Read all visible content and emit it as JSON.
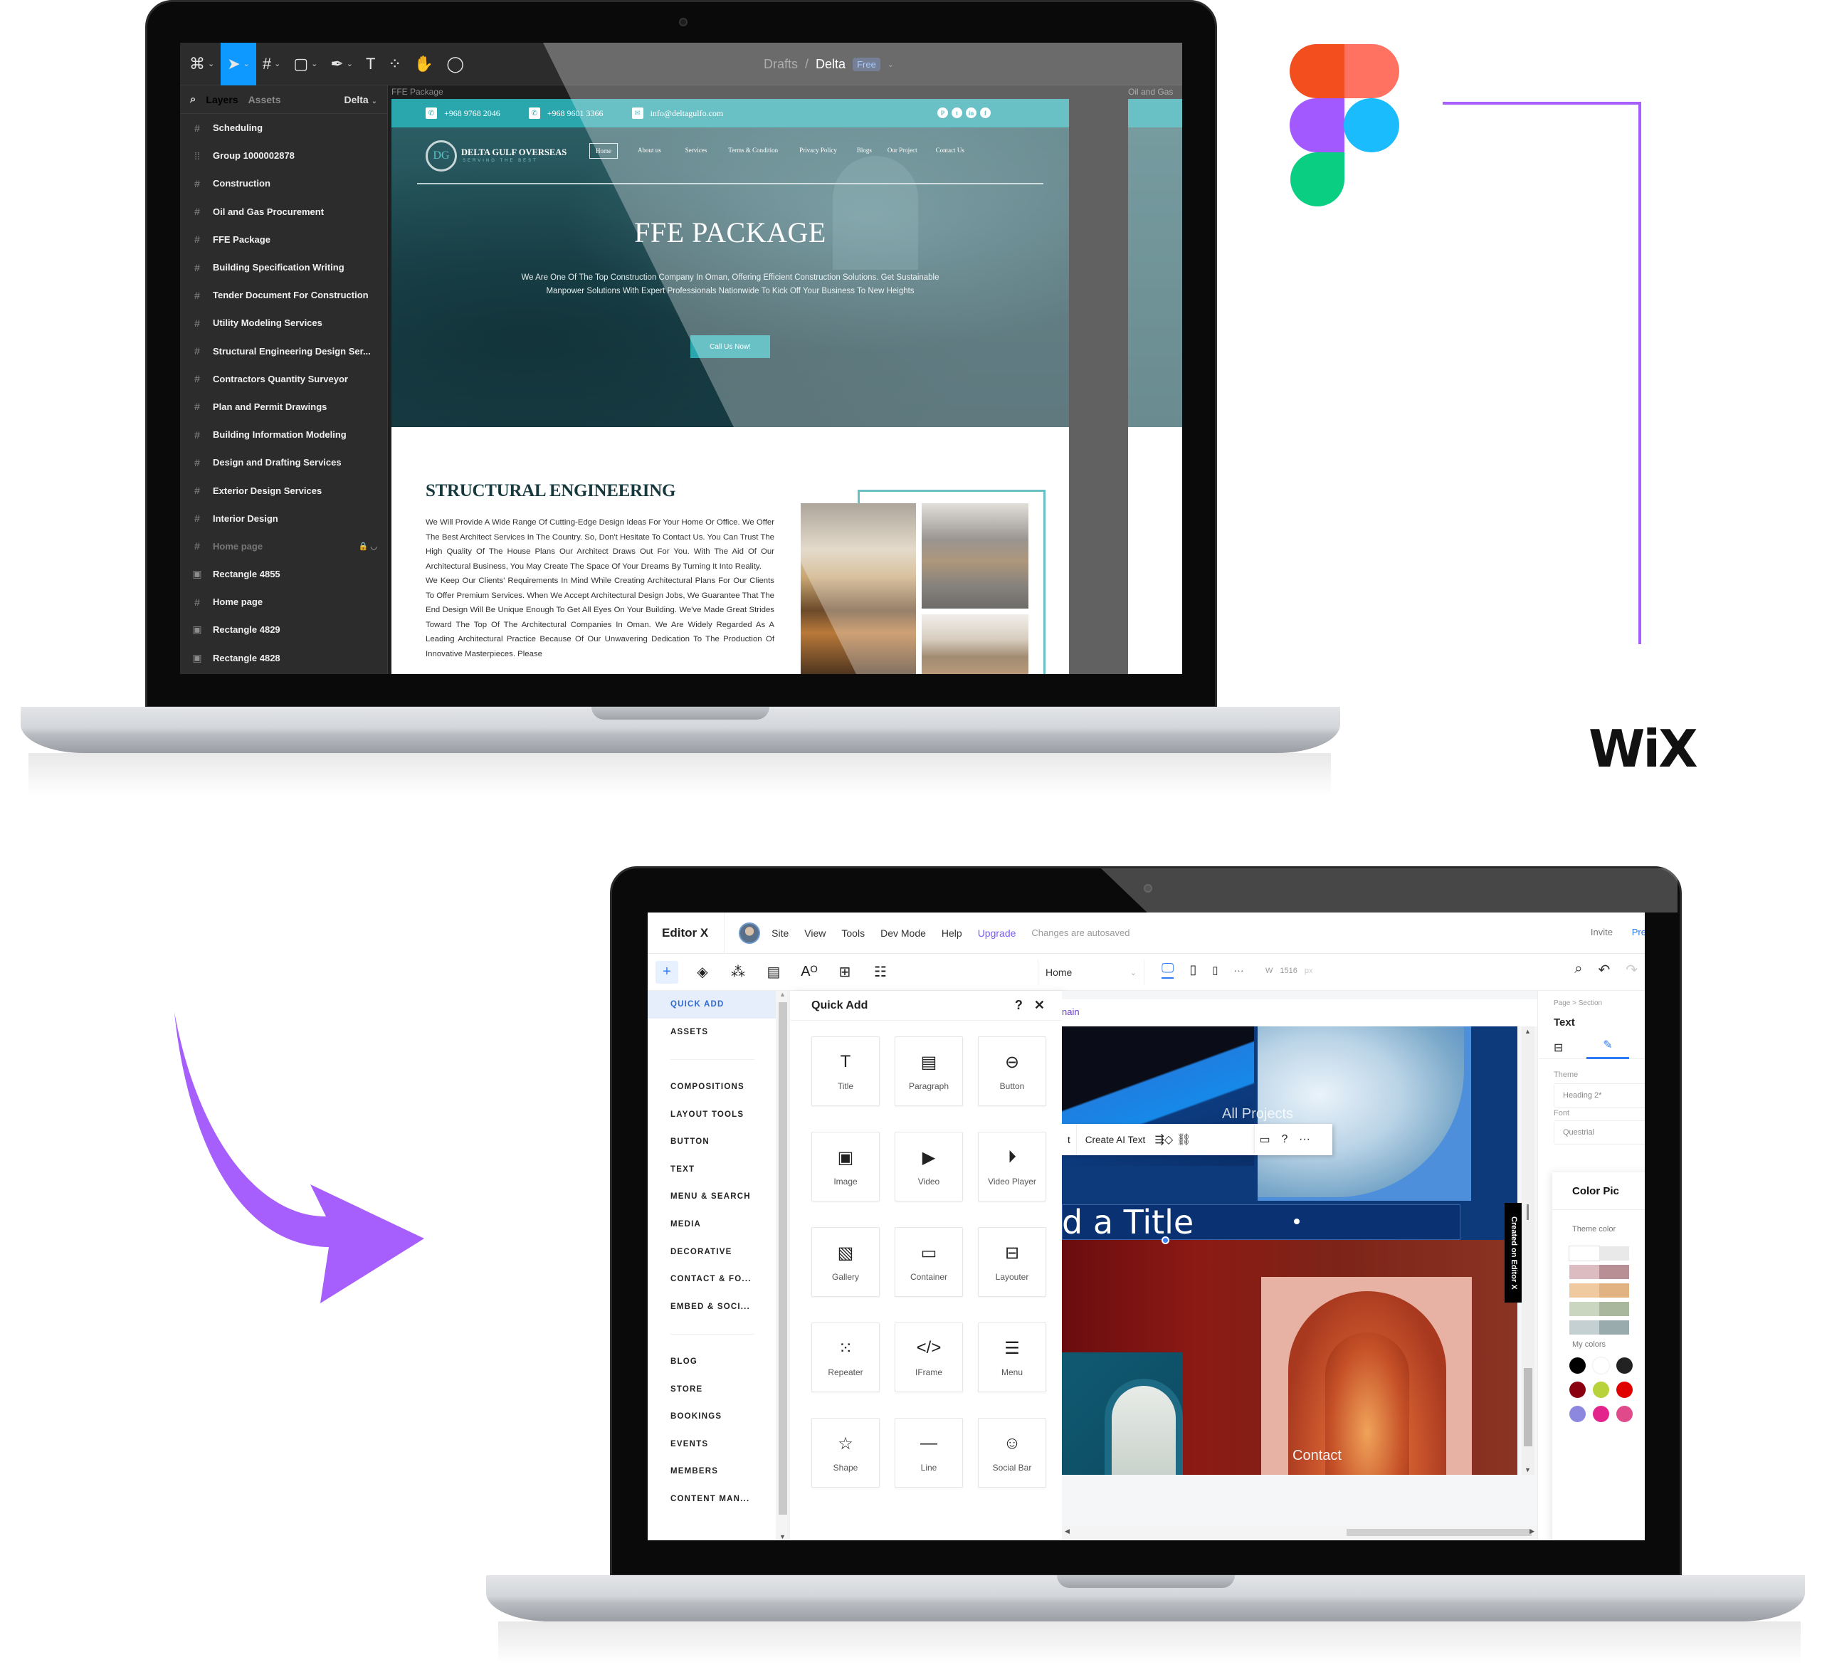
{
  "figma": {
    "toolbar": {
      "tools": [
        {
          "icon": "figma-menu-icon",
          "glyph": "⌘"
        },
        {
          "icon": "move-tool-icon",
          "glyph": "➤",
          "active": true
        },
        {
          "icon": "frame-tool-icon",
          "glyph": "#"
        },
        {
          "icon": "rectangle-tool-icon",
          "glyph": "▢"
        },
        {
          "icon": "pen-tool-icon",
          "glyph": "✒"
        },
        {
          "icon": "text-tool-icon",
          "glyph": "T"
        },
        {
          "icon": "components-icon",
          "glyph": "⁘"
        },
        {
          "icon": "hand-tool-icon",
          "glyph": "✋"
        },
        {
          "icon": "comment-tool-icon",
          "glyph": "◯"
        }
      ],
      "breadcrumb_root": "Drafts",
      "separator": "/",
      "file_name": "Delta",
      "plan_badge": "Free"
    },
    "layers_panel": {
      "tab_layers": "Layers",
      "tab_assets": "Assets",
      "page_name": "Delta",
      "items": [
        {
          "label": "Scheduling",
          "type": "frame"
        },
        {
          "label": "Group 1000002878",
          "type": "group"
        },
        {
          "label": "Construction",
          "type": "frame"
        },
        {
          "label": "Oil and Gas Procurement",
          "type": "frame"
        },
        {
          "label": "FFE Package",
          "type": "frame"
        },
        {
          "label": "Building Specification Writing",
          "type": "frame"
        },
        {
          "label": "Tender Document For Construction",
          "type": "frame"
        },
        {
          "label": "Utility Modeling Services",
          "type": "frame"
        },
        {
          "label": "Structural Engineering Design Ser...",
          "type": "frame"
        },
        {
          "label": "Contractors Quantity Surveyor",
          "type": "frame"
        },
        {
          "label": "Plan and Permit Drawings",
          "type": "frame"
        },
        {
          "label": "Building Information Modeling",
          "type": "frame"
        },
        {
          "label": "Design and Drafting Services",
          "type": "frame"
        },
        {
          "label": "Exterior Design Services",
          "type": "frame"
        },
        {
          "label": "Interior Design",
          "type": "frame"
        },
        {
          "label": "Home page",
          "type": "frame",
          "hidden": true,
          "locked": true
        },
        {
          "label": "Rectangle 4855",
          "type": "image"
        },
        {
          "label": "Home page",
          "type": "frame"
        },
        {
          "label": "Rectangle 4829",
          "type": "image"
        },
        {
          "label": "Rectangle 4828",
          "type": "image"
        }
      ]
    },
    "canvas": {
      "frame_label": "FFE Package",
      "frame2_label": "Oil and Gas",
      "website": {
        "phone1": "+968 9768 2046",
        "phone2": "+968 9601 3366",
        "email": "info@deltagulfo.com",
        "social": [
          "P",
          "t",
          "in",
          "f"
        ],
        "brand": "DELTA GULF OVERSEAS",
        "brand_tagline": "SERVING THE BEST",
        "logo_mark": "DG",
        "nav": [
          "Home",
          "About us",
          "Services",
          "Terms & Condition",
          "Privacy Policy",
          "Blogs",
          "Our Project",
          "Contact Us"
        ],
        "hero_title": "FFE PACKAGE",
        "hero_text": "We Are One Of The Top Construction Company In Oman, Offering Efficient Construction Solutions. Get Sustainable Manpower Solutions With Expert Professionals Nationwide To Kick Off Your Business To New Heights",
        "hero_button": "Call Us Now!",
        "section_title": "STRUCTURAL ENGINEERING",
        "section_text": "We Will Provide A Wide Range Of Cutting-Edge Design Ideas For Your Home Or Office. We Offer The Best Architect Services In The Country. So, Don't Hesitate To Contact Us. You Can Trust The High Quality Of The House Plans Our Architect Draws Out For You. With The Aid Of Our Architectural Business, You May Create The Space Of Your Dreams By Turning It Into Reality.",
        "section_text2": "We Keep Our Clients' Requirements In Mind While Creating Architectural Plans For Our Clients To Offer Premium Services. When We Accept Architectural Design Jobs, We Guarantee That The End Design Will Be Unique Enough To Get All Eyes On Your Building. We've Made Great Strides Toward The Top Of The Architectural Companies In Oman. We Are Widely Regarded As A Leading Architectural Practice Because Of Our Unwavering Dedication To The Production Of Innovative Masterpieces. Please",
        "accent_color": "#2aa6ad"
      }
    }
  },
  "wix": {
    "menubar": {
      "brand": "Editor X",
      "menus": [
        "Site",
        "View",
        "Tools",
        "Dev Mode",
        "Help"
      ],
      "upgrade": "Upgrade",
      "status": "Changes are autosaved",
      "invite": "Invite",
      "preview": "Pre"
    },
    "toolbar": {
      "icons": [
        {
          "name": "add-icon",
          "glyph": "+",
          "active": true
        },
        {
          "name": "layers-icon",
          "glyph": "◈"
        },
        {
          "name": "components-icon",
          "glyph": "⁂"
        },
        {
          "name": "pages-icon",
          "glyph": "▤"
        },
        {
          "name": "theme-icon",
          "glyph": "Aᴼ"
        },
        {
          "name": "apps-icon",
          "glyph": "⊞"
        },
        {
          "name": "cms-icon",
          "glyph": "☷"
        }
      ],
      "page": "Home",
      "width_label": "W",
      "width_value": "1516",
      "width_unit": "px",
      "more": "···"
    },
    "left_nav": {
      "items": [
        {
          "label": "QUICK ADD",
          "active": true
        },
        {
          "label": "ASSETS"
        },
        {
          "sep": true
        },
        {
          "label": "COMPOSITIONS"
        },
        {
          "label": "LAYOUT TOOLS"
        },
        {
          "label": "BUTTON"
        },
        {
          "label": "TEXT"
        },
        {
          "label": "MENU & SEARCH"
        },
        {
          "label": "MEDIA"
        },
        {
          "label": "DECORATIVE"
        },
        {
          "label": "CONTACT & FO..."
        },
        {
          "label": "EMBED & SOCI..."
        },
        {
          "sep": true
        },
        {
          "label": "BLOG"
        },
        {
          "label": "STORE"
        },
        {
          "label": "BOOKINGS"
        },
        {
          "label": "EVENTS"
        },
        {
          "label": "MEMBERS"
        },
        {
          "label": "CONTENT MAN..."
        }
      ]
    },
    "quick_add": {
      "title": "Quick Add",
      "help": "?",
      "close": "✕",
      "items": [
        {
          "label": "Title",
          "glyph": "T",
          "icon": "title-icon"
        },
        {
          "label": "Paragraph",
          "glyph": "▤",
          "icon": "paragraph-icon"
        },
        {
          "label": "Button",
          "glyph": "⊖",
          "icon": "button-icon"
        },
        {
          "label": "Image",
          "glyph": "▣",
          "icon": "image-icon"
        },
        {
          "label": "Video",
          "glyph": "▶",
          "icon": "video-icon"
        },
        {
          "label": "Video Player",
          "glyph": "⏵",
          "icon": "video-player-icon"
        },
        {
          "label": "Gallery",
          "glyph": "▧",
          "icon": "gallery-icon"
        },
        {
          "label": "Container",
          "glyph": "▭",
          "icon": "container-icon"
        },
        {
          "label": "Layouter",
          "glyph": "⊟",
          "icon": "layouter-icon"
        },
        {
          "label": "Repeater",
          "glyph": "⁙",
          "icon": "repeater-icon"
        },
        {
          "label": "IFrame",
          "glyph": "</>",
          "icon": "iframe-icon"
        },
        {
          "label": "Menu",
          "glyph": "☰",
          "icon": "menu-icon"
        },
        {
          "label": "Shape",
          "glyph": "☆",
          "icon": "shape-icon"
        },
        {
          "label": "Line",
          "glyph": "—",
          "icon": "line-icon"
        },
        {
          "label": "Social Bar",
          "glyph": "☺",
          "icon": "social-bar-icon"
        }
      ]
    },
    "canvas": {
      "section_tag": "nain",
      "floating_toolbar": {
        "cut_label": "t",
        "ai_text": "Create AI Text",
        "icons": [
          "animation-icon",
          "link-icon",
          "comment-icon",
          "help-icon",
          "more-icon"
        ],
        "glyphs": [
          "⇶◇",
          "⛓",
          "💬",
          "?",
          "···"
        ]
      },
      "title_text": "d a Title",
      "label_projects": "All Projects",
      "label_contact": "Contact",
      "created_tag": "Created on Editor X"
    },
    "right_panel": {
      "breadcrumb": "Page  >  Section",
      "title": "Text",
      "theme_label": "Theme",
      "theme_value": "Heading 2*",
      "font_label": "Font",
      "font_value": "Questrial",
      "color_picker_title": "Color Pic",
      "theme_colors_label": "Theme color",
      "my_colors_label": "My colors",
      "theme_swatches": [
        [
          "#ffffff",
          "#e9e9e9"
        ],
        [
          "#dcbcc1",
          "#b98f96"
        ],
        [
          "#efc9a0",
          "#e2b382"
        ],
        [
          "#cbd6c0",
          "#a9b79c"
        ],
        [
          "#c5d0d2",
          "#9aabae"
        ]
      ],
      "my_colors": [
        [
          "#000000",
          "#ffffff",
          "#222222"
        ],
        [
          "#8a0010",
          "#b7d23a",
          "#e00000"
        ],
        [
          "#8c88e0",
          "#e2248c",
          "#e04a8a"
        ]
      ]
    }
  },
  "decor": {
    "wix_logo": "WiX",
    "accent_purple": "#a65efc",
    "figma_colors": [
      "#f24e1e",
      "#ff7262",
      "#a259ff",
      "#1abcfe",
      "#0acf83"
    ]
  }
}
